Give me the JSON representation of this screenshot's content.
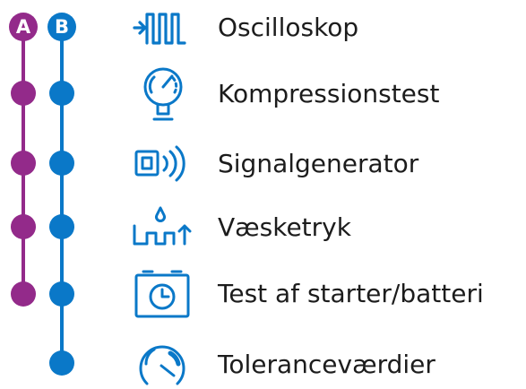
{
  "columns": {
    "a": {
      "label": "A",
      "color": "#932a8a"
    },
    "b": {
      "label": "B",
      "color": "#0a78c8"
    }
  },
  "icon_color": "#0a78c8",
  "features": [
    {
      "label": "Oscilloskop",
      "icon": "oscilloscope-icon",
      "a": true,
      "b": true
    },
    {
      "label": "Kompressionstest",
      "icon": "pressure-gauge-icon",
      "a": true,
      "b": true
    },
    {
      "label": "Signalgenerator",
      "icon": "signal-generator-icon",
      "a": true,
      "b": true
    },
    {
      "label": "Væsketryk",
      "icon": "fluid-pressure-icon",
      "a": true,
      "b": true
    },
    {
      "label": "Test af starter/batteri",
      "icon": "battery-clock-icon",
      "a": true,
      "b": true
    },
    {
      "label": "Toleranceværdier",
      "icon": "tolerance-gauge-icon",
      "a": false,
      "b": true
    }
  ]
}
